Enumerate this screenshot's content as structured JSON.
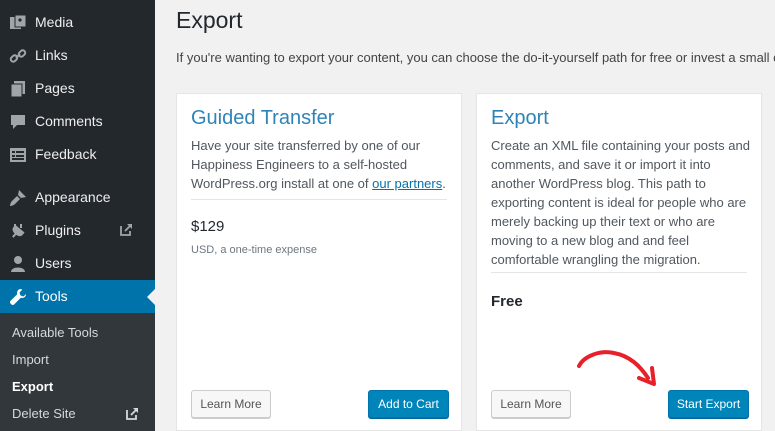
{
  "sidebar": {
    "items": [
      {
        "label": "Media"
      },
      {
        "label": "Links"
      },
      {
        "label": "Pages"
      },
      {
        "label": "Comments"
      },
      {
        "label": "Feedback"
      },
      {
        "label": "Appearance"
      },
      {
        "label": "Plugins"
      },
      {
        "label": "Users"
      },
      {
        "label": "Tools"
      }
    ],
    "submenu": [
      {
        "label": "Available Tools"
      },
      {
        "label": "Import"
      },
      {
        "label": "Export"
      },
      {
        "label": "Delete Site"
      }
    ]
  },
  "page": {
    "title": "Export",
    "intro": "If you're wanting to export your content, you can choose the do-it-yourself path for free or invest a small one"
  },
  "guided": {
    "title": "Guided Transfer",
    "desc_line1": "Have your site transferred by one of our",
    "desc_line2": "Happiness Engineers to a self-hosted",
    "desc_line3": "WordPress.org install at one of",
    "desc_link": "our partners",
    "desc_end": ".",
    "price": "$129",
    "price_note": "USD, a one-time expense",
    "learn_more": "Learn More",
    "add_to_cart": "Add to Cart"
  },
  "export": {
    "title": "Export",
    "desc_lines": [
      "Create an XML file containing your posts and",
      "comments, and save it or import it into",
      "another WordPress blog. This path to",
      "exporting content is ideal for people who are",
      "merely backing up their text or who are",
      "moving to a new blog and and feel",
      "comfortable wrangling the migration."
    ],
    "price": "Free",
    "learn_more": "Learn More",
    "start_export": "Start Export"
  },
  "colors": {
    "sidebar_bg": "#23282d",
    "active": "#0073aa",
    "primary_button": "#0085ba",
    "annotation_arrow": "#e8202a"
  }
}
